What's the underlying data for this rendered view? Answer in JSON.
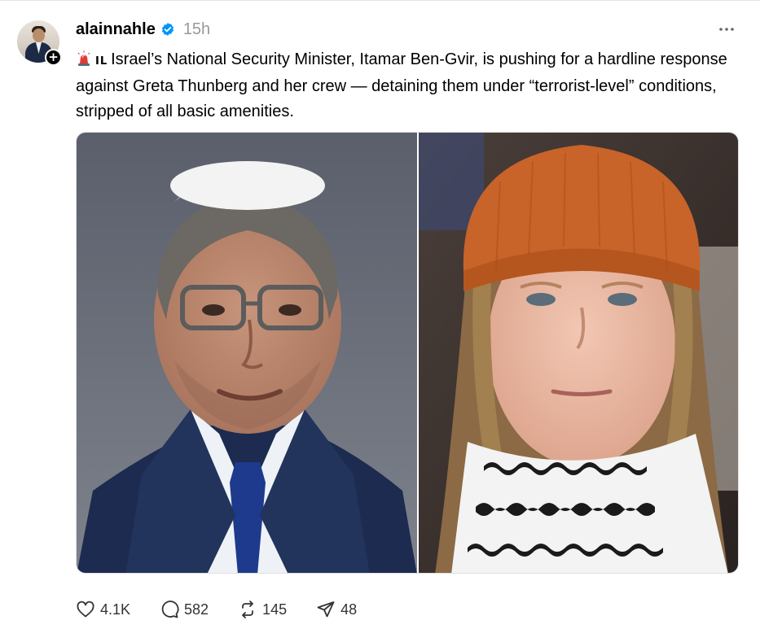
{
  "post": {
    "username": "alainnahle",
    "timestamp": "15h",
    "flag_code": "IL",
    "text": "Israel’s National Security Minister, Itamar Ben-Gvir, is pushing for a hardline response against Greta Thunberg and her crew — detaining them under “terrorist-level” conditions, stripped of all basic amenities.",
    "icons": {
      "alert": "police-light-icon",
      "verified": "verified-badge-icon",
      "follow": "plus-icon",
      "more": "more-icon"
    }
  },
  "actions": {
    "likes": "4.1K",
    "replies": "582",
    "reposts": "145",
    "shares": "48",
    "icons": [
      "heart-icon",
      "comment-icon",
      "repost-icon",
      "share-icon"
    ]
  },
  "colors": {
    "text": "#000000",
    "muted": "#999999",
    "verified": "#0095f6"
  }
}
